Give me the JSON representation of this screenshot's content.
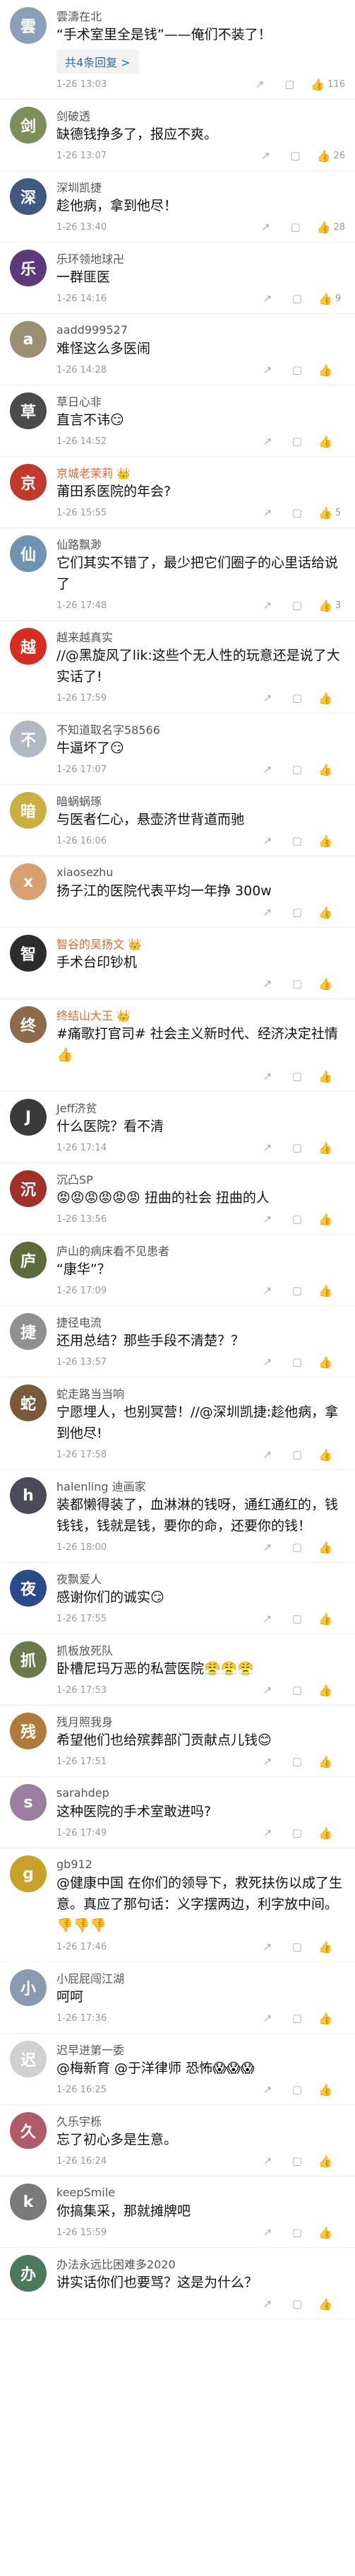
{
  "icons": {
    "share": "↗",
    "comment": "▢",
    "like": "👍"
  },
  "comments": [
    {
      "name": "雲濤在北",
      "text": "“手术室里全是钱”——俺们不装了！",
      "reply": "共4条回复 >",
      "time": "1-26 13:03",
      "likes": "116",
      "avatar_color": "#8aa0b8",
      "avatar_char": "雲"
    },
    {
      "name": "剑破透",
      "text": "缺德钱挣多了，报应不爽。",
      "time": "1-26 13:07",
      "likes": "26",
      "avatar_color": "#7a8f5a",
      "avatar_char": "剑"
    },
    {
      "name": "深圳凯捷",
      "text": "趁他病，拿到他尽！",
      "time": "1-26 13:40",
      "likes": "28",
      "avatar_color": "#3d5a80",
      "avatar_char": "深"
    },
    {
      "name": "乐环领地球卍",
      "text": "一群匪医",
      "time": "1-26 14:16",
      "likes": "9",
      "avatar_color": "#5a3a7a",
      "avatar_char": "乐"
    },
    {
      "name": "aadd999527",
      "text": "难怪这么多医闹",
      "time": "1-26 14:28",
      "likes": "",
      "avatar_color": "#9a8f70",
      "avatar_char": "a"
    },
    {
      "name": "草日心非",
      "text": "直言不讳😏",
      "time": "1-26 14:52",
      "likes": "",
      "avatar_color": "#4b4b4b",
      "avatar_char": "草"
    },
    {
      "name": "京城老茉莉 👑",
      "vip": true,
      "text": "莆田系医院的年会?",
      "time": "1-26 15:55",
      "likes": "5",
      "avatar_color": "#c0392b",
      "avatar_char": "京"
    },
    {
      "name": "仙路飘渺",
      "text": "它们其实不错了，最少把它们圈子的心里话给说了",
      "time": "1-26 17:48",
      "likes": "3",
      "avatar_color": "#6f93b0",
      "avatar_char": "仙"
    },
    {
      "name": "越来越真实",
      "text": "//@黑旋风了lik:这些个无人性的玩意还是说了大实话了!",
      "time": "1-26 17:59",
      "likes": "",
      "avatar_color": "#d62d20",
      "avatar_char": "越"
    },
    {
      "name": "不知道取名字58566",
      "text": "牛逼坏了😏",
      "time": "1-26 17:07",
      "likes": "",
      "avatar_color": "#b0b8c4",
      "avatar_char": "不"
    },
    {
      "name": "暗蜗蜗琢",
      "text": "与医者仁心，悬壶济世背道而驰",
      "time": "1-26 16:06",
      "likes": "",
      "avatar_color": "#c9b040",
      "avatar_char": "暗"
    },
    {
      "name": "xiaosezhu",
      "text": "扬子江的医院代表平均一年挣 300w",
      "time": "",
      "likes": "",
      "avatar_color": "#d8a070",
      "avatar_char": "x"
    },
    {
      "name": "智谷的吴扬文 👑",
      "vip": true,
      "text": "手术台印钞机",
      "time": "",
      "likes": "",
      "avatar_color": "#2c2c2c",
      "avatar_char": "智"
    },
    {
      "name": "终结山大王 👑",
      "vip": true,
      "text": "#痛歌打官司# 社会主义新时代、经济决定社情👍",
      "time": "",
      "likes": "",
      "avatar_color": "#8c6a4a",
      "avatar_char": "终"
    },
    {
      "name": "Jeff济贫",
      "text": "什么医院？看不清",
      "time": "1-26 17:14",
      "likes": "",
      "avatar_color": "#3a3a3a",
      "avatar_char": "J"
    },
    {
      "name": "沉凸SP",
      "text": "😡😡😡😡😡😡 扭曲的社会 扭曲的人",
      "time": "1-26 13:56",
      "likes": "",
      "avatar_color": "#a0302a",
      "avatar_char": "沉"
    },
    {
      "name": "庐山的病床看不见患者",
      "text": "“康华”？",
      "time": "1-26 17:09",
      "likes": "",
      "avatar_color": "#5c6b3a",
      "avatar_char": "庐"
    },
    {
      "name": "捷径电流",
      "text": "还用总结？那些手段不清楚？？",
      "time": "1-26 13:57",
      "likes": "",
      "avatar_color": "#909090",
      "avatar_char": "捷"
    },
    {
      "name": "蛇走路当当响",
      "text": "宁愿埋人，也别冥营！//@深圳凯捷:趁他病，拿到他尽!",
      "time": "1-26 17:58",
      "likes": "",
      "avatar_color": "#7a5a3a",
      "avatar_char": "蛇"
    },
    {
      "name": "halenling 迪画家",
      "text": "装都懒得装了，血淋淋的钱呀，通红通红的，钱钱钱，钱就是钱，要你的命，还要你的钱！",
      "time": "1-26 18:00",
      "likes": "",
      "avatar_color": "#4a4a5a",
      "avatar_char": "h"
    },
    {
      "name": "夜飘爱人",
      "text": "感谢你们的诚实😏",
      "time": "1-26 17:55",
      "likes": "",
      "avatar_color": "#2a4a8a",
      "avatar_char": "夜"
    },
    {
      "name": "抓板放死队",
      "text": "卧槽尼玛万恶的私营医院😤😤😤",
      "time": "1-26 17:53",
      "likes": "",
      "avatar_color": "#6a7a4a",
      "avatar_char": "抓"
    },
    {
      "name": "残月照我身",
      "text": "希望他们也给殡葬部门贡献点儿钱😊",
      "time": "1-26 17:51",
      "likes": "",
      "avatar_color": "#b07a3a",
      "avatar_char": "残"
    },
    {
      "name": "sarahdep",
      "text": "这种医院的手术室敢进吗?",
      "time": "1-26 17:49",
      "likes": "",
      "avatar_color": "#9a7fa0",
      "avatar_char": "s"
    },
    {
      "name": "gb912",
      "text": "@健康中国 在你们的领导下，救死扶伤以成了生意。真应了那句话：义字摆两边，利字放中间。👎👎👎",
      "time": "1-26 17:46",
      "likes": "",
      "avatar_color": "#c8a02a",
      "avatar_char": "g"
    },
    {
      "name": "小屁屁闯江湖",
      "text": "呵呵",
      "time": "1-26 17:36",
      "likes": "",
      "avatar_color": "#8a9ab0",
      "avatar_char": "小"
    },
    {
      "name": "迟早进第一委",
      "text": "@梅新育 @于洋律师 恐怖😱😱😱",
      "time": "1-26 16:25",
      "likes": "",
      "avatar_color": "#d0d0d0",
      "avatar_char": "迟"
    },
    {
      "name": "久乐宇栎",
      "text": "忘了初心多是生意。",
      "time": "1-26 16:24",
      "likes": "",
      "avatar_color": "#b05a6a",
      "avatar_char": "久"
    },
    {
      "name": "keepSmile",
      "text": "你搞集采，那就摊牌吧",
      "time": "1-26 15:59",
      "likes": "",
      "avatar_color": "#7a7a7a",
      "avatar_char": "k"
    },
    {
      "name": "办法永远比困难多2020",
      "text": "讲实话你们也要骂？这是为什么？",
      "time": "",
      "likes": "",
      "avatar_color": "#4a7a5a",
      "avatar_char": "办"
    }
  ]
}
